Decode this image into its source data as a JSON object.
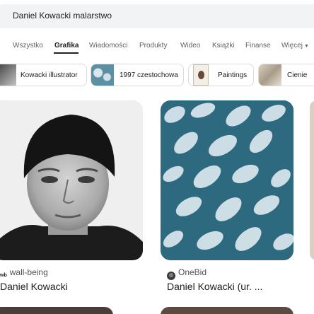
{
  "search": {
    "query": "Daniel Kowacki malarstwo"
  },
  "tabs": [
    {
      "label": "Wszystko",
      "active": false
    },
    {
      "label": "Grafika",
      "active": true
    },
    {
      "label": "Wiadomości",
      "active": false
    },
    {
      "label": "Produkty",
      "active": false
    },
    {
      "label": "Wideo",
      "active": false
    },
    {
      "label": "Książki",
      "active": false
    },
    {
      "label": "Finanse",
      "active": false
    },
    {
      "label": "Więcej",
      "active": false
    }
  ],
  "chips": [
    {
      "label": "Kowacki illustrator"
    },
    {
      "label": "1997 czestochowa"
    },
    {
      "label": "Paintings"
    },
    {
      "label": "Cienie"
    }
  ],
  "results": [
    {
      "source": "wall-being",
      "source_icon": "wb",
      "title": "Daniel Kowacki"
    },
    {
      "source": "OneBid",
      "title": "Daniel Kowacki (ur. ..."
    }
  ],
  "colors": {
    "accent": "#202124",
    "muted": "#5f6368",
    "chip_border": "#dadce0",
    "search_bg": "#f1f3f4"
  }
}
